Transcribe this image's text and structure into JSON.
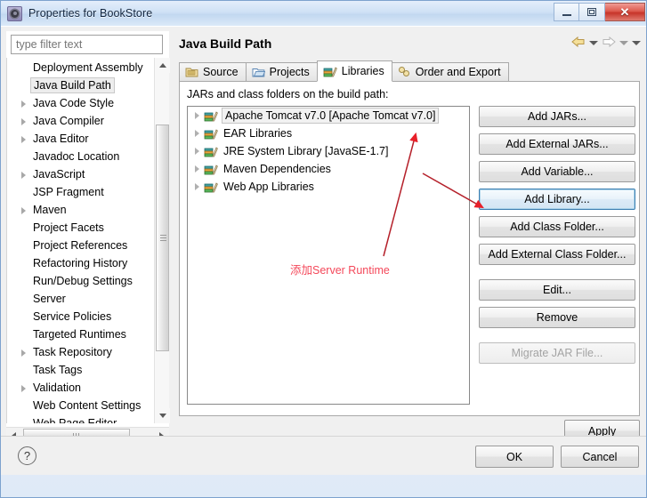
{
  "window": {
    "title": "Properties for BookStore",
    "app_icon": "gear-icon",
    "controls": {
      "minimize": "minimize-icon",
      "maximize": "maximize-icon",
      "close": "✕"
    }
  },
  "sidebar": {
    "filter": {
      "placeholder": "type filter text",
      "value": ""
    },
    "items": [
      {
        "label": "Deployment Assembly",
        "expandable": false,
        "selected": false
      },
      {
        "label": "Java Build Path",
        "expandable": false,
        "selected": true
      },
      {
        "label": "Java Code Style",
        "expandable": true,
        "selected": false
      },
      {
        "label": "Java Compiler",
        "expandable": true,
        "selected": false
      },
      {
        "label": "Java Editor",
        "expandable": true,
        "selected": false
      },
      {
        "label": "Javadoc Location",
        "expandable": false,
        "selected": false
      },
      {
        "label": "JavaScript",
        "expandable": true,
        "selected": false
      },
      {
        "label": "JSP Fragment",
        "expandable": false,
        "selected": false
      },
      {
        "label": "Maven",
        "expandable": true,
        "selected": false
      },
      {
        "label": "Project Facets",
        "expandable": false,
        "selected": false
      },
      {
        "label": "Project References",
        "expandable": false,
        "selected": false
      },
      {
        "label": "Refactoring History",
        "expandable": false,
        "selected": false
      },
      {
        "label": "Run/Debug Settings",
        "expandable": false,
        "selected": false
      },
      {
        "label": "Server",
        "expandable": false,
        "selected": false
      },
      {
        "label": "Service Policies",
        "expandable": false,
        "selected": false
      },
      {
        "label": "Targeted Runtimes",
        "expandable": false,
        "selected": false
      },
      {
        "label": "Task Repository",
        "expandable": true,
        "selected": false
      },
      {
        "label": "Task Tags",
        "expandable": false,
        "selected": false
      },
      {
        "label": "Validation",
        "expandable": true,
        "selected": false
      },
      {
        "label": "Web Content Settings",
        "expandable": false,
        "selected": false
      },
      {
        "label": "Web Page Editor",
        "expandable": false,
        "selected": false
      }
    ]
  },
  "main": {
    "page_title": "Java Build Path",
    "nav": {
      "back_icon": "back-arrow-icon",
      "back_menu_icon": "chevron-down-icon",
      "forward_icon": "forward-arrow-icon",
      "forward_menu_icon": "chevron-down-icon",
      "view_menu_icon": "chevron-down-icon"
    },
    "tabs": [
      {
        "label": "Source",
        "icon": "source-folder-icon",
        "active": false
      },
      {
        "label": "Projects",
        "icon": "projects-folder-icon",
        "active": false
      },
      {
        "label": "Libraries",
        "icon": "library-icon",
        "active": true
      },
      {
        "label": "Order and Export",
        "icon": "order-export-icon",
        "active": false
      }
    ],
    "caption": "JARs and class folders on the build path:",
    "libraries": [
      {
        "label": "Apache Tomcat v7.0 [Apache Tomcat v7.0]",
        "icon": "library-icon",
        "selected": true
      },
      {
        "label": "EAR Libraries",
        "icon": "library-icon",
        "selected": false
      },
      {
        "label": "JRE System Library [JavaSE-1.7]",
        "icon": "library-icon",
        "selected": false
      },
      {
        "label": "Maven Dependencies",
        "icon": "library-icon",
        "selected": false
      },
      {
        "label": "Web App Libraries",
        "icon": "library-icon",
        "selected": false
      }
    ],
    "buttons": [
      {
        "label": "Add JARs...",
        "state": "normal"
      },
      {
        "label": "Add External JARs...",
        "state": "normal"
      },
      {
        "label": "Add Variable...",
        "state": "normal"
      },
      {
        "label": "Add Library...",
        "state": "focused"
      },
      {
        "label": "Add Class Folder...",
        "state": "normal"
      },
      {
        "label": "Add External Class Folder...",
        "state": "normal"
      },
      {
        "label": "Edit...",
        "state": "normal"
      },
      {
        "label": "Remove",
        "state": "normal"
      },
      {
        "label": "Migrate JAR File...",
        "state": "disabled"
      }
    ],
    "apply_label": "Apply"
  },
  "footer": {
    "help_icon": "?",
    "ok_label": "OK",
    "cancel_label": "Cancel"
  },
  "annotation": {
    "text": "添加Server Runtime",
    "color": "#f4485a"
  }
}
